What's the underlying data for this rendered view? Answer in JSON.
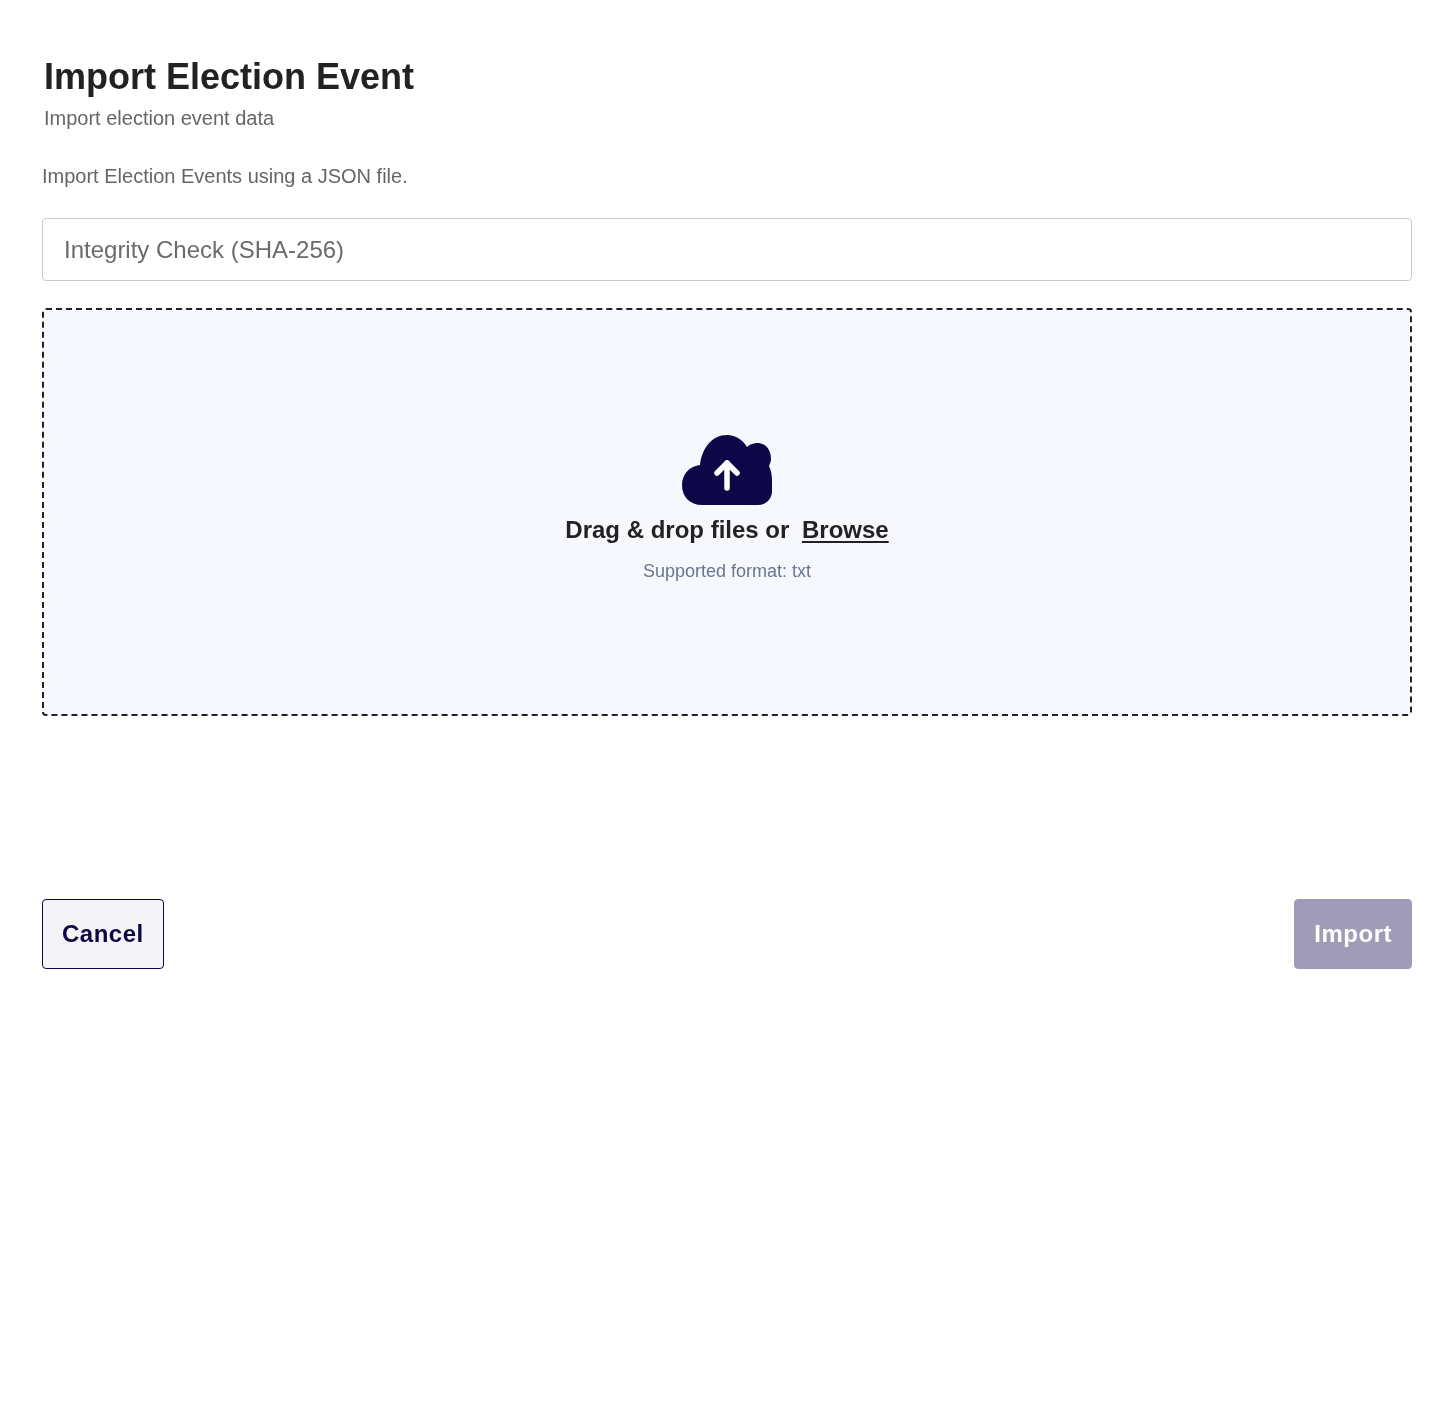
{
  "header": {
    "title": "Import Election Event",
    "subtitle": "Import election event data"
  },
  "description": "Import Election Events using a JSON file.",
  "hash_field": {
    "placeholder": "Integrity Check (SHA-256)"
  },
  "dropzone": {
    "prompt": "Drag & drop files or",
    "link": "Browse",
    "hint": "Supported format: txt"
  },
  "buttons": [
    {
      "label": "Cancel",
      "kind": "secondary",
      "disabled": false
    },
    {
      "label": "Import",
      "kind": "primary",
      "disabled": true
    }
  ]
}
